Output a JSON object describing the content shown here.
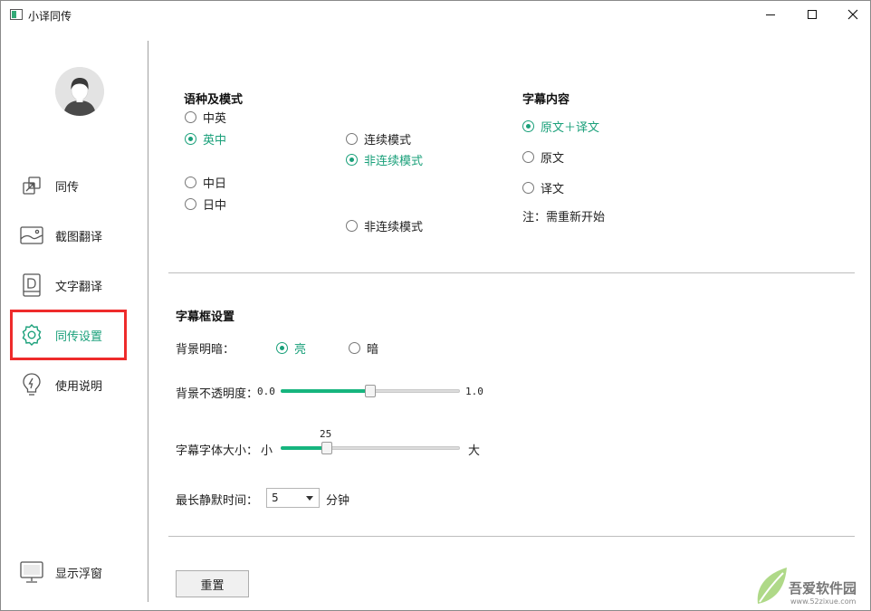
{
  "window": {
    "title": "小译同传"
  },
  "sidebar": {
    "items": [
      {
        "label": "同传",
        "icon": "transfer-icon"
      },
      {
        "label": "截图翻译",
        "icon": "image-icon"
      },
      {
        "label": "文字翻译",
        "icon": "document-icon"
      },
      {
        "label": "同传设置",
        "icon": "gear-icon",
        "active": true
      },
      {
        "label": "使用说明",
        "icon": "lightbulb-icon"
      }
    ],
    "bottom_item": {
      "label": "显示浮窗",
      "icon": "monitor-icon"
    }
  },
  "language_mode": {
    "title": "语种及模式",
    "options": [
      "中英",
      "英中",
      "中日",
      "日中"
    ],
    "selected": "英中",
    "mode_options": [
      "连续模式",
      "非连续模式",
      "非连续模式"
    ],
    "mode_selected": "非连续模式"
  },
  "subtitle_content": {
    "title": "字幕内容",
    "options": [
      "原文＋译文",
      "原文",
      "译文"
    ],
    "selected": "原文＋译文",
    "note": "注：需重新开始"
  },
  "subtitle_box": {
    "title": "字幕框设置",
    "brightness_label": "背景明暗：",
    "brightness_options": [
      "亮",
      "暗"
    ],
    "brightness_selected": "亮",
    "opacity_label": "背景不透明度：",
    "opacity_min": "0.0",
    "opacity_max": "1.0",
    "opacity_value": 0.5,
    "font_size_label": "字幕字体大小：",
    "font_size_min": "小",
    "font_size_max": "大",
    "font_size_value": "25",
    "font_size_fraction": 0.24,
    "silence_label": "最长静默时间：",
    "silence_value": "5",
    "silence_unit": "分钟"
  },
  "reset_label": "重置",
  "accent_color": "#1aa07a",
  "watermark": {
    "brand": "吾爱软件园",
    "url": "www.52zixue.com"
  }
}
